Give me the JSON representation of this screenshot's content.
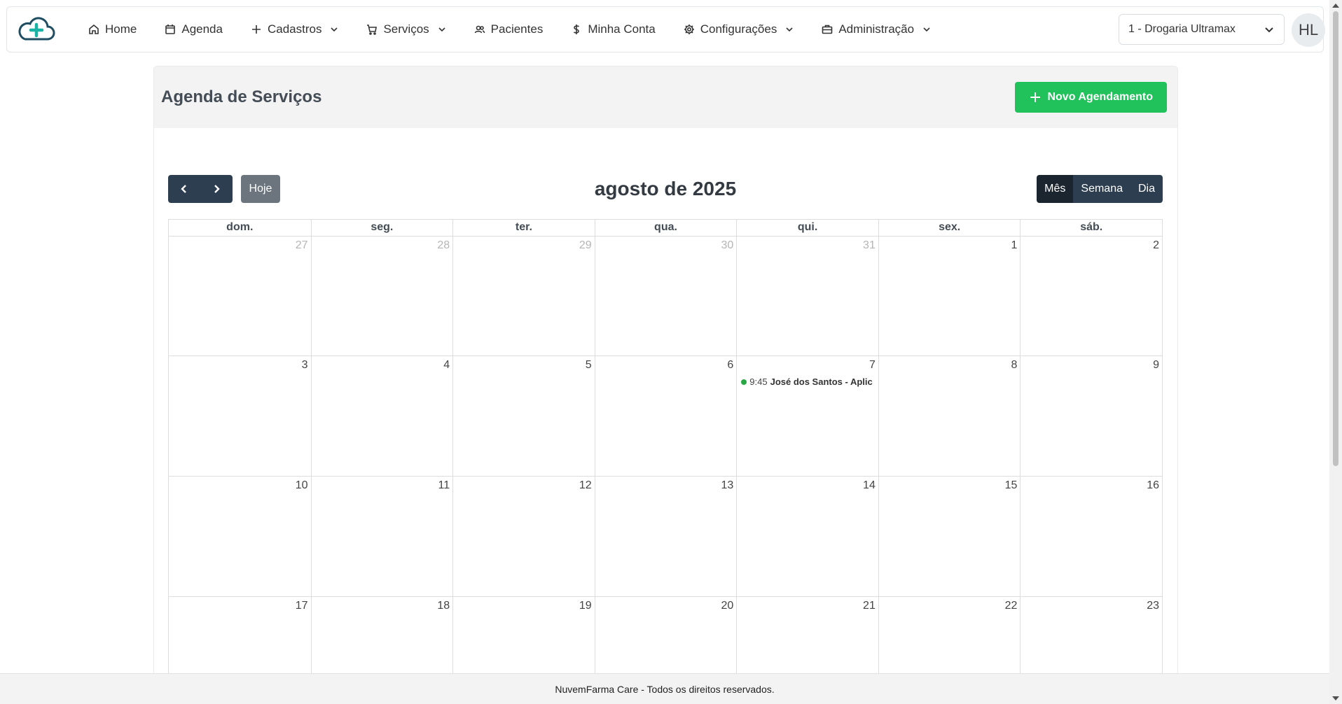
{
  "nav": {
    "items": [
      {
        "label": "Home",
        "icon": "home-icon",
        "dropdown": false
      },
      {
        "label": "Agenda",
        "icon": "calendar-icon",
        "dropdown": false
      },
      {
        "label": "Cadastros",
        "icon": "plus-icon",
        "dropdown": true
      },
      {
        "label": "Serviços",
        "icon": "cart-icon",
        "dropdown": true
      },
      {
        "label": "Pacientes",
        "icon": "users-icon",
        "dropdown": false
      },
      {
        "label": "Minha Conta",
        "icon": "dollar-icon",
        "dropdown": false
      },
      {
        "label": "Configurações",
        "icon": "gear-icon",
        "dropdown": true
      },
      {
        "label": "Administração",
        "icon": "briefcase-icon",
        "dropdown": true
      }
    ],
    "store_select": "1 - Drogaria Ultramax",
    "avatar_initials": "HL"
  },
  "page": {
    "title": "Agenda de Serviços",
    "new_button": "Novo Agendamento"
  },
  "calendar": {
    "title": "agosto de 2025",
    "today_label": "Hoje",
    "views": [
      "Mês",
      "Semana",
      "Dia"
    ],
    "active_view": "Mês",
    "weekdays": [
      "dom.",
      "seg.",
      "ter.",
      "qua.",
      "qui.",
      "sex.",
      "sáb."
    ],
    "weeks": [
      [
        {
          "n": "27",
          "other": true
        },
        {
          "n": "28",
          "other": true
        },
        {
          "n": "29",
          "other": true
        },
        {
          "n": "30",
          "other": true
        },
        {
          "n": "31",
          "other": true
        },
        {
          "n": "1"
        },
        {
          "n": "2"
        }
      ],
      [
        {
          "n": "3"
        },
        {
          "n": "4"
        },
        {
          "n": "5"
        },
        {
          "n": "6"
        },
        {
          "n": "7",
          "event": {
            "time": "9:45",
            "title": "José dos Santos - Aplic"
          }
        },
        {
          "n": "8"
        },
        {
          "n": "9"
        }
      ],
      [
        {
          "n": "10"
        },
        {
          "n": "11"
        },
        {
          "n": "12"
        },
        {
          "n": "13"
        },
        {
          "n": "14"
        },
        {
          "n": "15"
        },
        {
          "n": "16"
        }
      ],
      [
        {
          "n": "17"
        },
        {
          "n": "18"
        },
        {
          "n": "19"
        },
        {
          "n": "20"
        },
        {
          "n": "21"
        },
        {
          "n": "22"
        },
        {
          "n": "23"
        }
      ]
    ]
  },
  "colors": {
    "primary_dark": "#2c3e50",
    "success": "#21c15c",
    "event_dot": "#28a745",
    "brand": "#1a8f99"
  },
  "footer": {
    "text": "NuvemFarma Care - Todos os direitos reservados."
  }
}
